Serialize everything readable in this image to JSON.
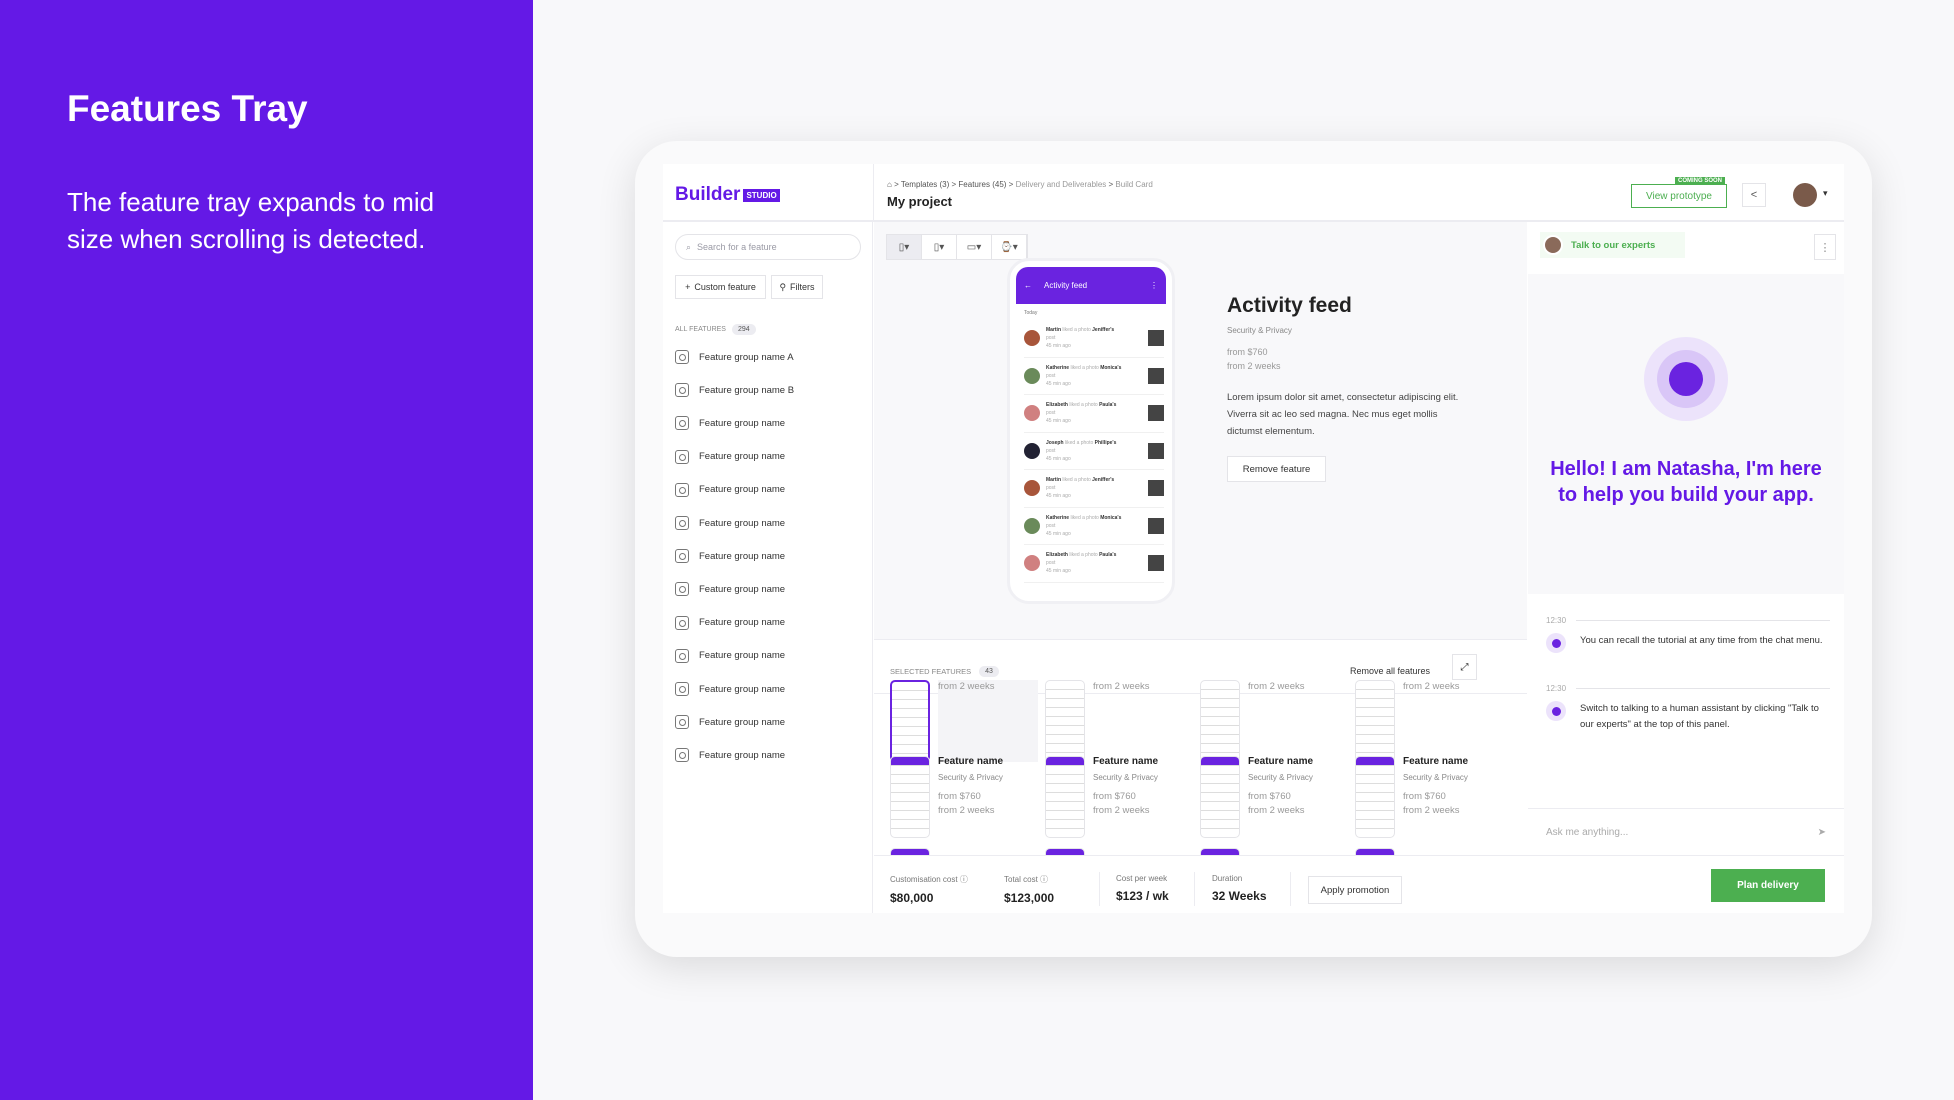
{
  "slide": {
    "title": "Features Tray",
    "description": "The feature tray expands to mid size when scrolling is detected."
  },
  "header": {
    "logo": "Builder",
    "logo_badge": "STUDIO",
    "breadcrumb": [
      "Templates (3)",
      "Features (45)",
      "Delivery and Deliverables",
      "Build Card"
    ],
    "project": "My project",
    "view_prototype": "View prototype",
    "coming_soon": "COMING SOON"
  },
  "sidebar": {
    "search_placeholder": "Search for a feature",
    "custom_feature": "Custom feature",
    "filters": "Filters",
    "all_features": "ALL FEATURES",
    "all_count": "294",
    "groups": [
      "Feature group name A",
      "Feature group name B",
      "Feature group name",
      "Feature group name",
      "Feature group name",
      "Feature group name",
      "Feature group name",
      "Feature group name",
      "Feature group name",
      "Feature group name",
      "Feature group name",
      "Feature group name",
      "Feature group name"
    ]
  },
  "preview": {
    "screen_title": "Activity feed",
    "today": "Today",
    "feed": [
      {
        "name": "Martin",
        "owner": "Jeniffer's",
        "time": "45 min ago"
      },
      {
        "name": "Katherine",
        "owner": "Monica's",
        "time": "45 min ago"
      },
      {
        "name": "Elizabeth",
        "owner": "Paula's",
        "time": "45 min ago"
      },
      {
        "name": "Joseph",
        "owner": "Phillipe's",
        "time": "45 min ago"
      },
      {
        "name": "Martin",
        "owner": "Jeniffer's",
        "time": "45 min ago"
      },
      {
        "name": "Katherine",
        "owner": "Monica's",
        "time": "45 min ago"
      },
      {
        "name": "Elizabeth",
        "owner": "Paula's",
        "time": "45 min ago"
      }
    ],
    "liked_text": "liked a photo",
    "post": "post"
  },
  "detail": {
    "title": "Activity feed",
    "category": "Security & Privacy",
    "price": "from $760",
    "duration": "from 2 weeks",
    "description": "Lorem ipsum dolor sit amet, consectetur adipiscing elit. Viverra sit ac leo sed magna. Nec mus eget mollis dictumst elementum.",
    "remove": "Remove feature"
  },
  "tray": {
    "label": "SELECTED FEATURES",
    "count": "43",
    "remove_all": "Remove all features",
    "partial_duration": "from 2 weeks",
    "cards": [
      {
        "name": "Feature name",
        "category": "Security & Privacy",
        "price": "from $760",
        "duration": "from 2 weeks"
      },
      {
        "name": "Feature name",
        "category": "Security & Privacy",
        "price": "from $760",
        "duration": "from 2 weeks"
      },
      {
        "name": "Feature name",
        "category": "Security & Privacy",
        "price": "from $760",
        "duration": "from 2 weeks"
      },
      {
        "name": "Feature name",
        "category": "Security & Privacy",
        "price": "from $760",
        "duration": "from 2 weeks"
      }
    ]
  },
  "footer": {
    "custom_cost_label": "Customisation cost",
    "custom_cost": "$80,000",
    "total_label": "Total cost",
    "total": "$123,000",
    "week_label": "Cost per week",
    "week": "$123 / wk",
    "duration_label": "Duration",
    "duration": "32 Weeks",
    "promo": "Apply promotion",
    "plan": "Plan delivery"
  },
  "assistant": {
    "talk": "Talk to our experts",
    "greeting": "Hello! I am Natasha, I'm here to help you build your app.",
    "messages": [
      {
        "time": "12:30",
        "text": "You can recall the tutorial at any time from the chat menu."
      },
      {
        "time": "12:30",
        "text": "Switch to talking to a human assistant by clicking \"Talk to our experts\" at the top of this panel."
      }
    ],
    "input_placeholder": "Ask me anything..."
  },
  "colors": {
    "brand": "#6419e6",
    "accent_green": "#4caf50"
  }
}
